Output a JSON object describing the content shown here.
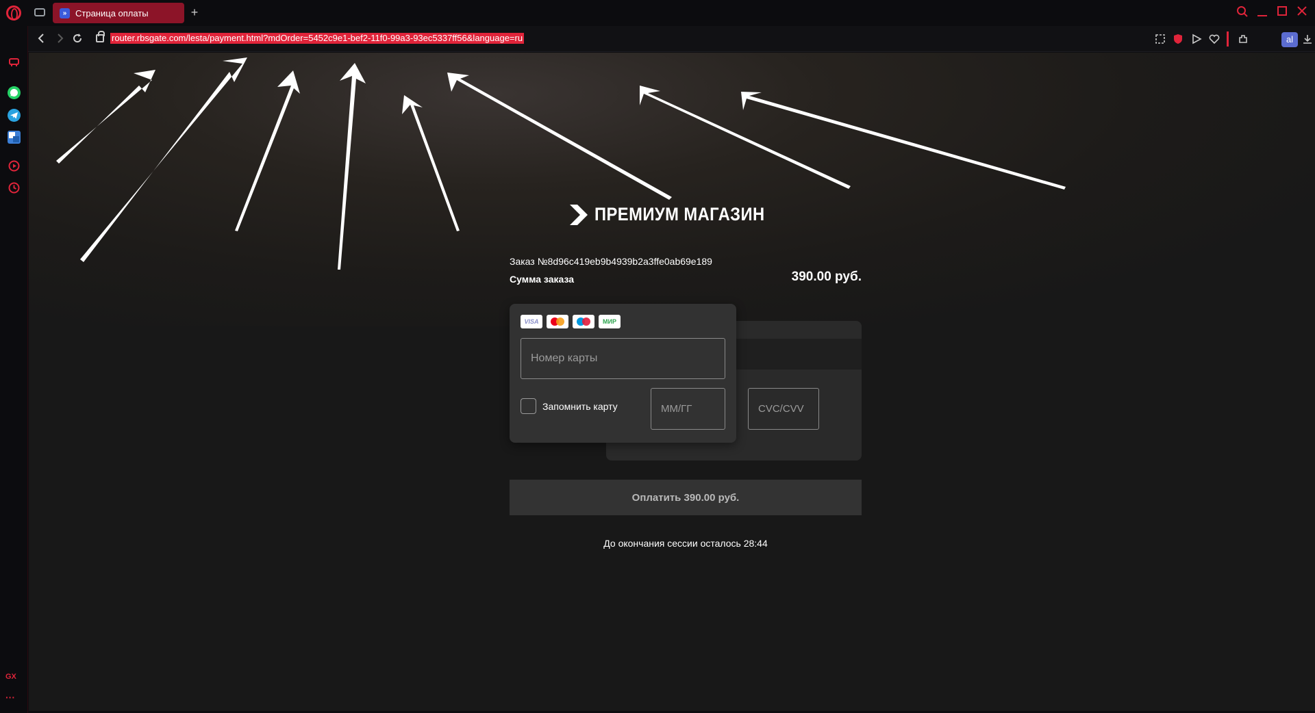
{
  "browser": {
    "tab_title": "Страница оплаты",
    "tab_favicon_glyph": "»",
    "new_tab_label": "+",
    "url": "router.rbsgate.com/lesta/payment.html?mdOrder=5452c9e1-bef2-11f0-99a3-93ec5337ff56&language=ru",
    "profile_initials": "al",
    "accent_color": "#e0243a",
    "sidebar_gx_label": "GX",
    "sidebar_more_label": "···"
  },
  "payment": {
    "brand_name": "ПРЕМИУМ МАГАЗИН",
    "order_number": "Заказ №8d96c419eb9b4939b2a3ffe0ab69e189",
    "sum_label": "Сумма заказа",
    "sum_value": "390.00 руб.",
    "card_logos": [
      "VISA",
      "mastercard",
      "maestro",
      "МИР"
    ],
    "card_number_placeholder": "Номер карты",
    "expiry_placeholder": "ММ/ГГ",
    "cvc_placeholder": "CVC/CVV",
    "remember_label": "Запомнить карту",
    "pay_button": "Оплатить 390.00 руб.",
    "session_text": "До окончания сессии осталось 28:44"
  }
}
